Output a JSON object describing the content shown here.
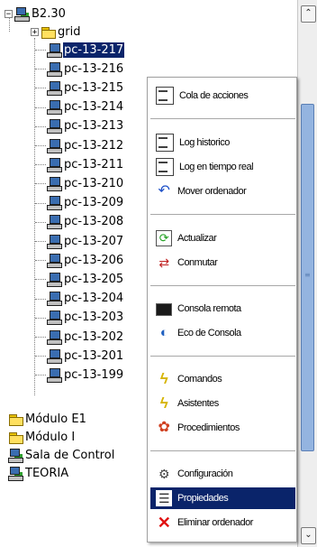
{
  "tree": {
    "root": {
      "label": "B2.30",
      "expander": "−"
    },
    "grid": {
      "label": "grid",
      "expander": "+"
    },
    "pcs": [
      "pc-13-217",
      "pc-13-216",
      "pc-13-215",
      "pc-13-214",
      "pc-13-213",
      "pc-13-212",
      "pc-13-211",
      "pc-13-210",
      "pc-13-209",
      "pc-13-208",
      "pc-13-207",
      "pc-13-206",
      "pc-13-205",
      "pc-13-204",
      "pc-13-203",
      "pc-13-202",
      "pc-13-201",
      "pc-13-199"
    ],
    "selected_pc": "pc-13-217",
    "folders": [
      {
        "label": "Módulo E1",
        "icon": "folder-icon"
      },
      {
        "label": "Módulo I",
        "icon": "folder-icon"
      },
      {
        "label": "Sala de Control",
        "icon": "network-icon"
      },
      {
        "label": "TEORIA",
        "icon": "network-icon"
      }
    ]
  },
  "scrollbar": {
    "up_glyph": "⌃",
    "down_glyph": "⌄",
    "grip_glyph": "≡"
  },
  "context_menu": {
    "items": [
      {
        "label": "Cola de acciones",
        "icon": "action-queue-icon"
      },
      {
        "label": "Log historico",
        "icon": "log-history-icon"
      },
      {
        "label": "Log en tiempo real",
        "icon": "log-realtime-icon"
      },
      {
        "label": "Mover ordenador",
        "icon": "move-icon"
      },
      {
        "label": "Actualizar",
        "icon": "refresh-icon"
      },
      {
        "label": "Conmutar",
        "icon": "switch-icon"
      },
      {
        "label": "Consola remota",
        "icon": "terminal-icon"
      },
      {
        "label": "Eco de Consola",
        "icon": "echo-icon"
      },
      {
        "label": "Comandos",
        "icon": "lightning-icon"
      },
      {
        "label": "Asistentes",
        "icon": "lightning-icon"
      },
      {
        "label": "Procedimientos",
        "icon": "procedures-icon"
      },
      {
        "label": "Configuración",
        "icon": "config-icon"
      },
      {
        "label": "Propiedades",
        "icon": "properties-icon"
      },
      {
        "label": "Eliminar ordenador",
        "icon": "delete-icon"
      }
    ],
    "highlighted": "Propiedades"
  }
}
